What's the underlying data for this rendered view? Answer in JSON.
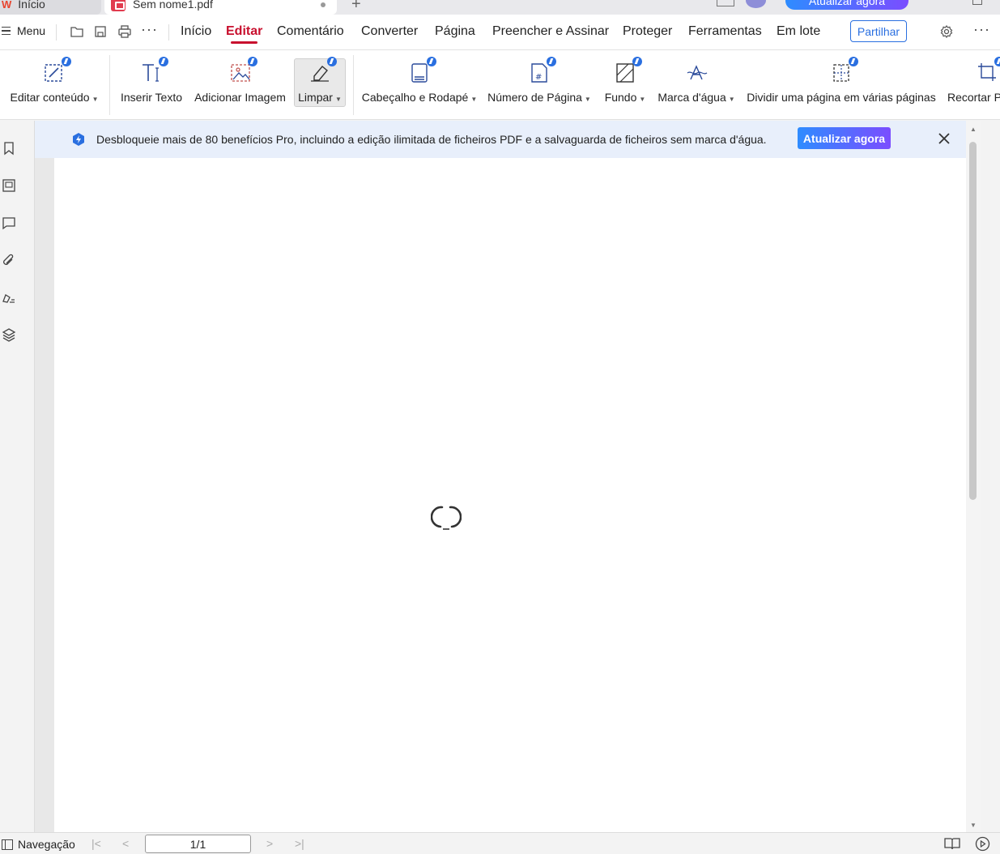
{
  "tabs": {
    "home_label": "Início",
    "doc_label": "Sem nome1.pdf",
    "new_tab_symbol": "+"
  },
  "titlebar": {
    "upgrade_label": "Atualizar agora"
  },
  "menubar": {
    "menu_label": "Menu",
    "more_symbol": "···",
    "tabs": [
      {
        "label": "Início"
      },
      {
        "label": "Editar"
      },
      {
        "label": "Comentário"
      },
      {
        "label": "Converter"
      },
      {
        "label": "Página"
      },
      {
        "label": "Preencher e Assinar"
      },
      {
        "label": "Proteger"
      },
      {
        "label": "Ferramentas"
      },
      {
        "label": "Em lote"
      }
    ],
    "active_tab": "Editar",
    "share_label": "Partilhar"
  },
  "ribbon": {
    "tools": [
      {
        "label": "Editar conteúdo",
        "icon": "edit-content-icon",
        "dropdown": true
      },
      {
        "label": "Inserir Texto",
        "icon": "insert-text-icon",
        "dropdown": false
      },
      {
        "label": "Adicionar Imagem",
        "icon": "add-image-icon",
        "dropdown": false
      },
      {
        "label": "Limpar",
        "icon": "eraser-icon",
        "dropdown": true
      },
      {
        "label": "Cabeçalho e Rodapé",
        "icon": "header-footer-icon",
        "dropdown": true
      },
      {
        "label": "Número de Página",
        "icon": "page-number-icon",
        "dropdown": true
      },
      {
        "label": "Fundo",
        "icon": "background-icon",
        "dropdown": true
      },
      {
        "label": "Marca d'água",
        "icon": "watermark-icon",
        "dropdown": true
      },
      {
        "label": "Dividir uma página em várias páginas",
        "icon": "split-page-icon",
        "dropdown": false
      },
      {
        "label": "Recortar P",
        "icon": "crop-icon",
        "dropdown": false
      }
    ],
    "selected_tool": "Limpar"
  },
  "banner": {
    "text": "Desbloqueie mais de 80 benefícios Pro, incluindo a edição ilimitada de ficheiros PDF e a salvaguarda de ficheiros sem marca d'água.",
    "button_label": "Atualizar agora"
  },
  "sidebar": {
    "icons": [
      "bookmark-icon",
      "thumbnail-icon",
      "comment-icon",
      "attachment-icon",
      "signature-icon",
      "layers-icon"
    ]
  },
  "statusbar": {
    "nav_label": "Navegação",
    "page_value": "1/1"
  },
  "colors": {
    "accent": "#c8102e",
    "primary_blue": "#2a6fe0",
    "gradient_start": "#2e8cff",
    "gradient_end": "#7b4dff"
  }
}
